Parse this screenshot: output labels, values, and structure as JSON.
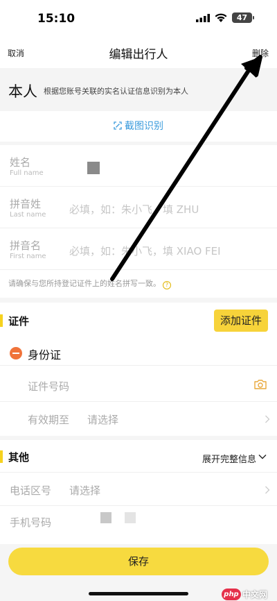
{
  "status_bar": {
    "time": "15:10",
    "battery": "47"
  },
  "nav": {
    "cancel": "取消",
    "title": "编辑出行人",
    "delete": "删除"
  },
  "self_banner": {
    "title": "本人",
    "desc": "根据您账号关联的实名认证信息识别为本人"
  },
  "scan": {
    "label": "截图识别"
  },
  "names": {
    "full_name": {
      "label": "姓名",
      "sub": "Full name"
    },
    "last_name": {
      "label": "拼音姓",
      "sub": "Last name",
      "placeholder": "必填，如：朱小飞，填 ZHU"
    },
    "first_name": {
      "label": "拼音名",
      "sub": "First name",
      "placeholder": "必填，如：朱小飞，填 XIAO FEI"
    },
    "hint": "请确保与您所持登记证件上的姓名拼写一致。",
    "hint_icon": "?"
  },
  "certificate": {
    "title": "证件",
    "add_button": "添加证件",
    "id_type": "身份证",
    "id_number_label": "证件号码",
    "validity_label": "有效期至",
    "validity_placeholder": "请选择"
  },
  "other": {
    "title": "其他",
    "expand": "展开完整信息",
    "area_code_label": "电话区号",
    "area_code_placeholder": "请选择",
    "phone_label": "手机号码"
  },
  "save": {
    "label": "保存"
  },
  "watermark": {
    "badge": "php",
    "text": "中文网"
  },
  "icons": {
    "scan": "scan-icon",
    "camera": "camera-icon",
    "chevron": "chevron-right-icon",
    "remove": "remove-circle-icon"
  },
  "colors": {
    "accent": "#f7d33a",
    "link": "#3a9bdc",
    "remove": "#f0733a"
  }
}
